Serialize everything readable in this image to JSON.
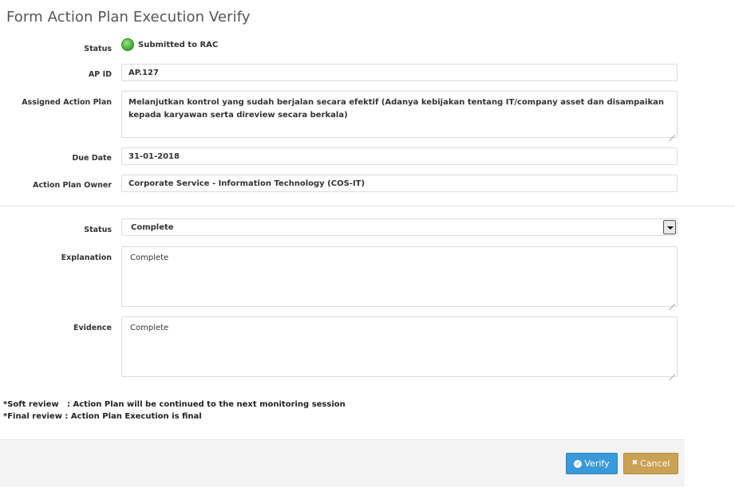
{
  "page": {
    "title": "Form Action Plan Execution Verify"
  },
  "info": {
    "status_label": "Status",
    "status_value": "Submitted to RAC",
    "status_color": "#4cb33a",
    "ap_id_label": "AP ID",
    "ap_id_value": "AP.127",
    "assigned_label": "Assigned Action Plan",
    "assigned_value": "Melanjutkan kontrol yang sudah berjalan secara efektif (Adanya kebijakan tentang IT/company asset dan disampaikan kepada karyawan serta direview secara berkala)",
    "due_label": "Due Date",
    "due_value": "31-01-2018",
    "owner_label": "Action Plan Owner",
    "owner_value": "Corporate Service - Information Technology (COS-IT)"
  },
  "form": {
    "status_label": "Status",
    "status_selected": "Complete",
    "explanation_label": "Explanation",
    "explanation_value": "Complete",
    "evidence_label": "Evidence",
    "evidence_value": "Complete"
  },
  "notes": {
    "soft": "*Soft review   : Action Plan will be continued to the next monitoring session",
    "final": "*Final review : Action Plan Execution is final"
  },
  "buttons": {
    "verify_label": "Verify",
    "verify_icon": "check-circle-icon",
    "verify_color": "#3a99d8",
    "cancel_label": "Cancel",
    "cancel_icon": "close-icon",
    "cancel_color": "#caa255"
  }
}
